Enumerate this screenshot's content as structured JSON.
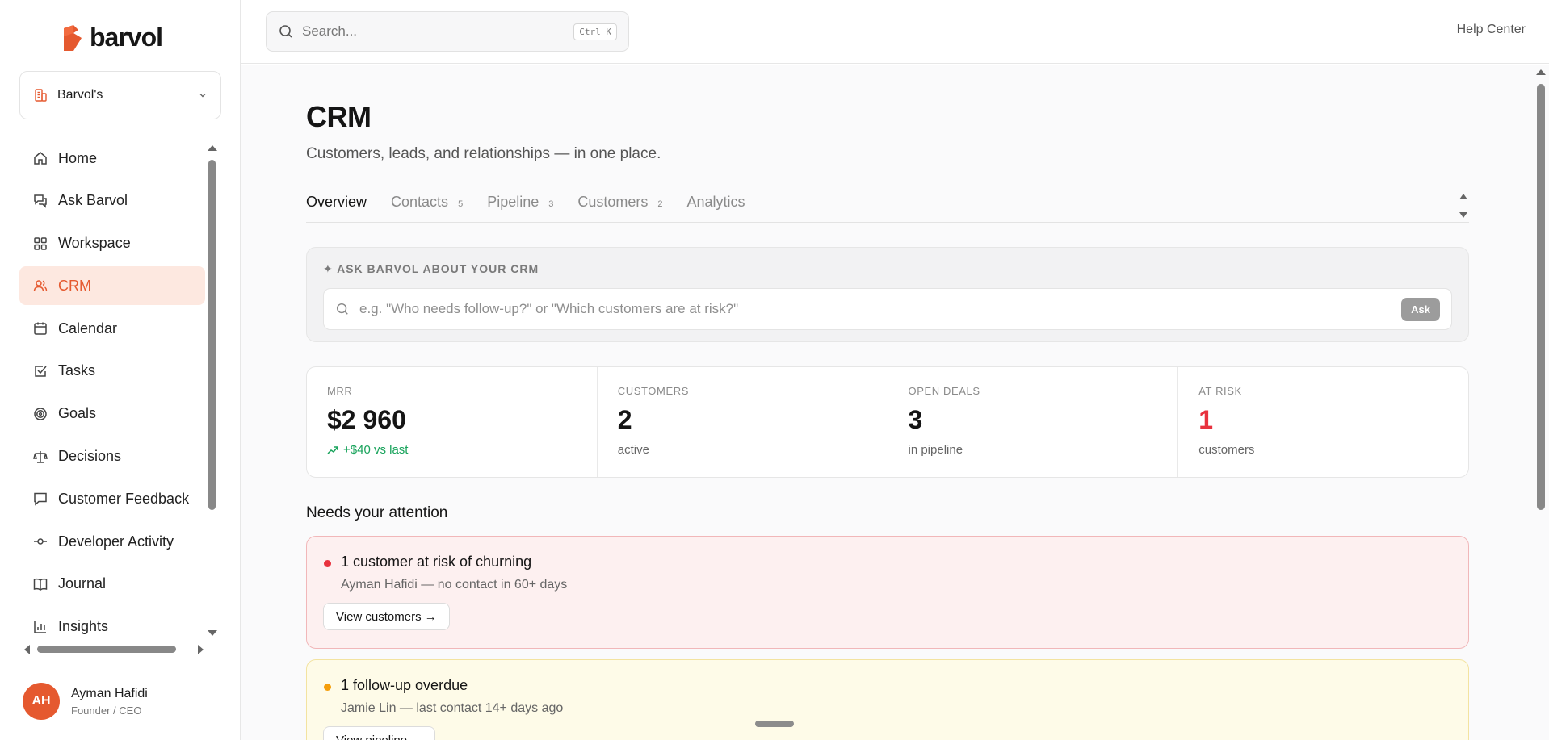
{
  "brand": {
    "name": "barvol",
    "accent": "#e5592f"
  },
  "org": {
    "name": "Barvol's"
  },
  "sidebar": {
    "items": [
      {
        "label": "Home",
        "icon": "home-icon"
      },
      {
        "label": "Ask Barvol",
        "icon": "chat-icon"
      },
      {
        "label": "Workspace",
        "icon": "grid-icon"
      },
      {
        "label": "CRM",
        "icon": "users-icon",
        "active": true
      },
      {
        "label": "Calendar",
        "icon": "calendar-icon"
      },
      {
        "label": "Tasks",
        "icon": "check-square-icon"
      },
      {
        "label": "Goals",
        "icon": "target-icon"
      },
      {
        "label": "Decisions",
        "icon": "scale-icon"
      },
      {
        "label": "Customer Feedback",
        "icon": "message-square-icon"
      },
      {
        "label": "Developer Activity",
        "icon": "git-commit-icon"
      },
      {
        "label": "Journal",
        "icon": "book-icon"
      },
      {
        "label": "Insights",
        "icon": "bar-chart-icon"
      }
    ]
  },
  "user": {
    "initials": "AH",
    "name": "Ayman Hafidi",
    "role": "Founder / CEO"
  },
  "topbar": {
    "search_placeholder": "Search...",
    "search_shortcut": "Ctrl K",
    "help_label": "Help Center"
  },
  "page": {
    "title": "CRM",
    "subtitle": "Customers, leads, and relationships — in one place.",
    "tabs": [
      {
        "label": "Overview",
        "count": "",
        "active": true
      },
      {
        "label": "Contacts",
        "count": "5"
      },
      {
        "label": "Pipeline",
        "count": "3"
      },
      {
        "label": "Customers",
        "count": "2"
      },
      {
        "label": "Analytics",
        "count": ""
      }
    ]
  },
  "ask": {
    "heading": "✦ ASK BARVOL ABOUT YOUR CRM",
    "placeholder": "e.g. \"Who needs follow-up?\" or \"Which customers are at risk?\"",
    "button": "Ask"
  },
  "stats": {
    "mrr": {
      "label": "MRR",
      "value": "$2 960",
      "sub": "+$40 vs last"
    },
    "customers": {
      "label": "CUSTOMERS",
      "value": "2",
      "sub": "active"
    },
    "open_deals": {
      "label": "OPEN DEALS",
      "value": "3",
      "sub": "in pipeline"
    },
    "at_risk": {
      "label": "AT RISK",
      "value": "1",
      "sub": "customers"
    }
  },
  "attention": {
    "title": "Needs your attention",
    "alerts": [
      {
        "title": "1 customer at risk of churning",
        "desc": "Ayman Hafidi — no contact in 60+ days",
        "button": "View customers →",
        "color": "#e8323e"
      },
      {
        "title": "1 follow-up overdue",
        "desc": "Jamie Lin — last contact 14+ days ago",
        "button": "View pipeline →",
        "color": "#f59e0b"
      }
    ]
  }
}
